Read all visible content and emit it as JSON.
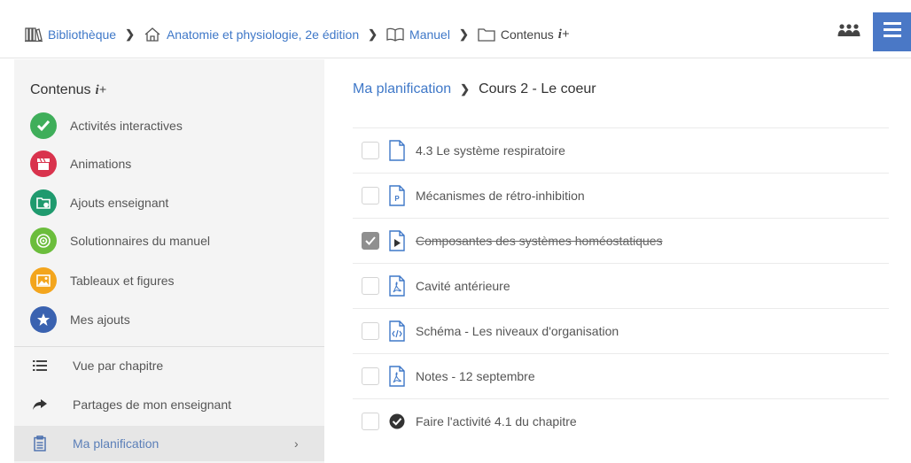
{
  "topbar": {
    "crumbs": [
      {
        "label": "Bibliothèque",
        "icon": "library-icon"
      },
      {
        "label": "Anatomie et physiologie, 2e édition",
        "icon": "home-icon"
      },
      {
        "label": "Manuel",
        "icon": "book-icon"
      },
      {
        "label": "Contenus",
        "icon": "folder-icon",
        "suffix": "i+"
      }
    ],
    "separator": "❯",
    "group_icon": "group-icon",
    "menu_icon": "hamburger-icon",
    "accent_color": "#4a78c6"
  },
  "sidebar": {
    "title": "Contenus",
    "title_suffix": "i+",
    "categories": [
      {
        "label": "Activités interactives",
        "icon": "check-icon",
        "color": "#3fae5a"
      },
      {
        "label": "Animations",
        "icon": "clapperboard-icon",
        "color": "#d9334d"
      },
      {
        "label": "Ajouts enseignant",
        "icon": "folder-add-icon",
        "color": "#1f9a6e"
      },
      {
        "label": "Solutionnaires du manuel",
        "icon": "target-icon",
        "color": "#6bbd3c"
      },
      {
        "label": "Tableaux et figures",
        "icon": "image-icon",
        "color": "#f3a51d"
      },
      {
        "label": "Mes ajouts",
        "icon": "star-icon",
        "color": "#3a62b0"
      }
    ],
    "links": [
      {
        "label": "Vue par chapitre",
        "icon": "list-icon"
      },
      {
        "label": "Partages de mon enseignant",
        "icon": "share-icon"
      },
      {
        "label": "Ma planification",
        "icon": "clipboard-icon",
        "active": true,
        "chevron": "›"
      }
    ]
  },
  "main": {
    "breadcrumb": {
      "link": "Ma planification",
      "separator": "❯",
      "current": "Cours 2 - Le coeur"
    },
    "items": [
      {
        "label": "4.3 Le système respiratoire",
        "icon": "document-icon",
        "checked": false
      },
      {
        "label": "Mécanismes de rétro-inhibition",
        "icon": "ppt-file-icon",
        "checked": false
      },
      {
        "label": "Composantes des systèmes homéostatiques",
        "icon": "video-file-icon",
        "checked": true
      },
      {
        "label": "Cavité antérieure",
        "icon": "pdf-file-icon",
        "checked": false
      },
      {
        "label": "Schéma - Les niveaux d'organisation",
        "icon": "code-file-icon",
        "checked": false
      },
      {
        "label": "Notes - 12 septembre",
        "icon": "pdf-file-icon",
        "checked": false
      },
      {
        "label": "Faire l'activité 4.1 du chapitre",
        "icon": "check-circle-icon",
        "checked": false
      }
    ]
  }
}
